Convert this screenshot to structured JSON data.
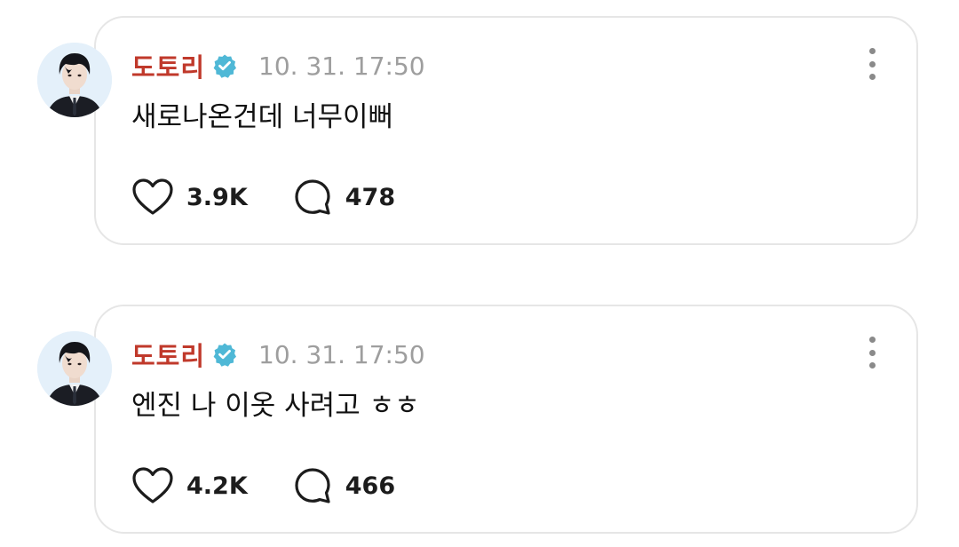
{
  "posts": [
    {
      "author": "도토리",
      "verified": true,
      "timestamp": "10. 31. 17:50",
      "text": "새로나온건데 너무이뻐",
      "likes": "3.9K",
      "comments": "478"
    },
    {
      "author": "도토리",
      "verified": true,
      "timestamp": "10. 31. 17:50",
      "text": "엔진 나 이옷 사려고 ㅎㅎ",
      "likes": "4.2K",
      "comments": "466"
    }
  ],
  "colors": {
    "author": "#c0392b",
    "verified_badge": "#4fb8d6",
    "timestamp": "#9e9e9e",
    "card_border": "#e6e6e6",
    "avatar_bg": "#e4f0fa"
  },
  "icons": {
    "like": "heart-icon",
    "comment": "comment-bubble-icon",
    "more": "more-vertical-icon",
    "verified": "verified-badge-icon"
  }
}
